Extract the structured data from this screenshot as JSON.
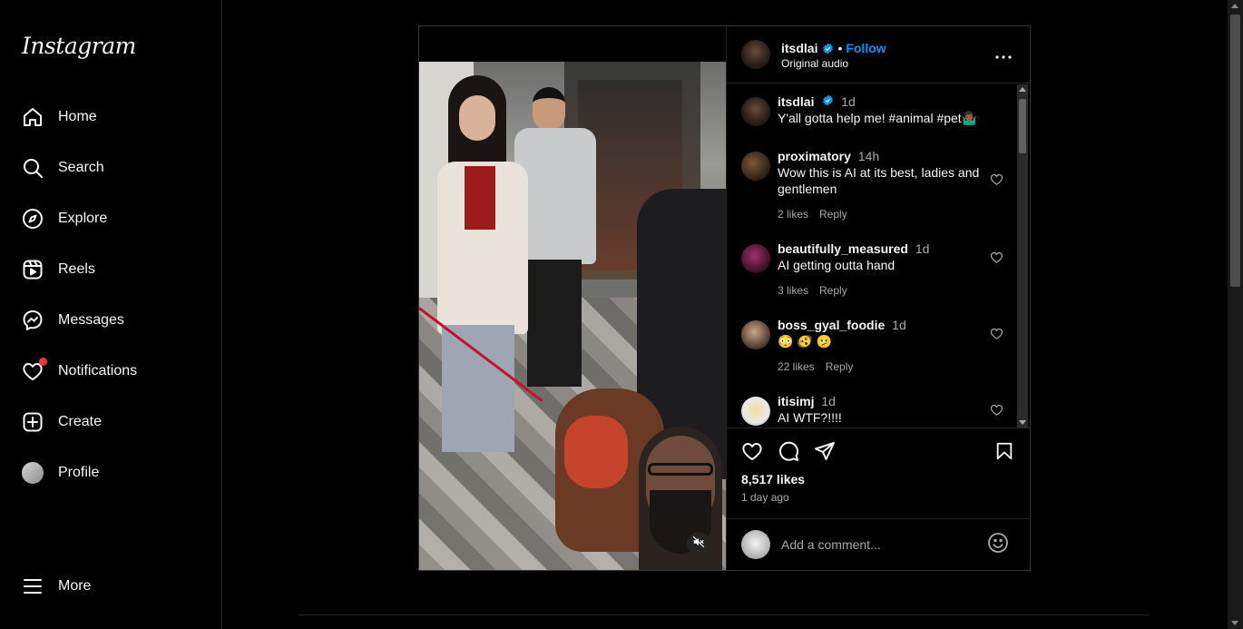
{
  "app": {
    "logo": "Instagram"
  },
  "sidebar": {
    "items": [
      {
        "label": "Home",
        "icon": "home-icon"
      },
      {
        "label": "Search",
        "icon": "search-icon"
      },
      {
        "label": "Explore",
        "icon": "compass-icon"
      },
      {
        "label": "Reels",
        "icon": "reels-icon"
      },
      {
        "label": "Messages",
        "icon": "messenger-icon"
      },
      {
        "label": "Notifications",
        "icon": "heart-icon"
      },
      {
        "label": "Create",
        "icon": "plus-square-icon"
      },
      {
        "label": "Profile",
        "icon": "avatar"
      }
    ],
    "more": {
      "label": "More",
      "icon": "menu-icon"
    }
  },
  "post": {
    "author": "itsdlai",
    "separator": "•",
    "follow_label": "Follow",
    "audio": "Original audio",
    "caption": {
      "user": "itsdlai",
      "time": "1d",
      "text": "Y'all gotta help me! #animal #pet🤷🏾‍♂️"
    },
    "comments": [
      {
        "user": "proximatory",
        "time": "14h",
        "text": "Wow this is AI at its best, ladies and gentlemen",
        "likes": "2 likes",
        "reply": "Reply"
      },
      {
        "user": "beautifully_measured",
        "time": "1d",
        "text": "AI getting outta hand",
        "likes": "3 likes",
        "reply": "Reply"
      },
      {
        "user": "boss_gyal_foodie",
        "time": "1d",
        "text": "😳 🫨 🫤",
        "likes": "22 likes",
        "reply": "Reply"
      },
      {
        "user": "itisimj",
        "time": "1d",
        "text": "AI WTF?!!!!",
        "likes": "",
        "reply": ""
      }
    ],
    "likes_count": "8,517 likes",
    "age": "1 day ago",
    "add_comment_placeholder": "Add a comment..."
  },
  "colors": {
    "accent": "#0095f6",
    "notification_dot": "#ff3040",
    "background": "#000000"
  }
}
